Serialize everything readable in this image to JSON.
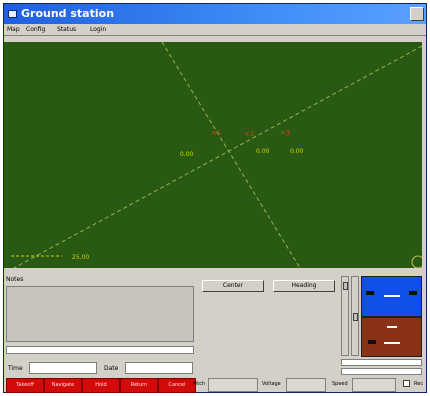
{
  "window": {
    "title": "Ground station"
  },
  "menu": [
    "Map",
    "Config",
    "Status",
    "Login"
  ],
  "map": {
    "background": "#285a14",
    "grid_color": "#9ab04a",
    "label_color": "#d4d010",
    "waypoint_color": "#d84010",
    "labels": [
      "0.00",
      "0.00",
      "0.00"
    ],
    "scale_label": "25.00"
  },
  "notes": {
    "label": "Notes"
  },
  "fields": {
    "time_label": "Time",
    "date_label": "Date"
  },
  "controls": {
    "center_label": "Center",
    "heading_label": "Heading"
  },
  "red_buttons": [
    "Takeoff",
    "Navigate",
    "Hold",
    "Return",
    "Cancel"
  ],
  "status": {
    "pitch_label": "Pitch",
    "voltage_label": "Voltage",
    "speed_label": "Speed",
    "checkbox_label": "Rec"
  },
  "attitude": {
    "sky": "#1050e8",
    "ground": "#8a3218"
  }
}
